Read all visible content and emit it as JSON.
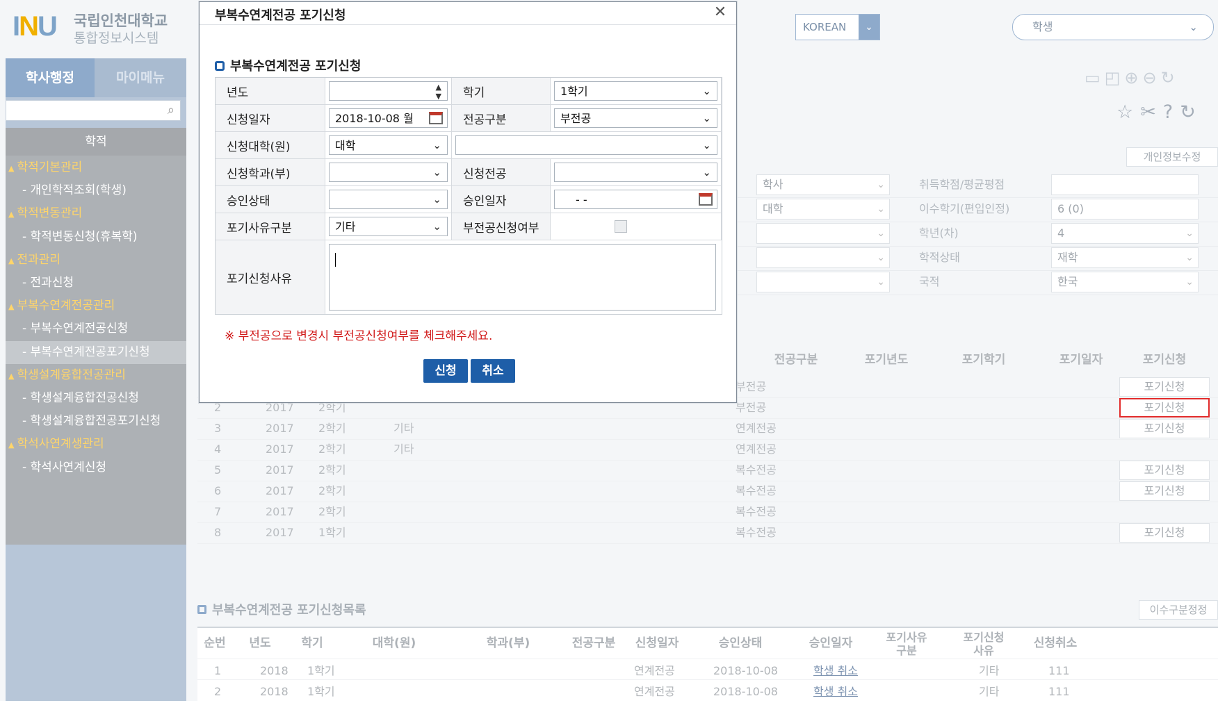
{
  "logo": {
    "mark": "INU",
    "name_line1": "국립인천대학교",
    "name_line2": "통합정보시스템"
  },
  "header": {
    "language": "KOREAN",
    "role": "학생"
  },
  "sidebar": {
    "tab_active": "학사행정",
    "tab_other": "마이메뉴",
    "section": "학적",
    "items": [
      {
        "label": "학적기본관리",
        "type": "cat"
      },
      {
        "label": "- 개인학적조회(학생)",
        "type": "sub"
      },
      {
        "label": "학적변동관리",
        "type": "cat"
      },
      {
        "label": "- 학적변동신청(휴복학)",
        "type": "sub"
      },
      {
        "label": "전과관리",
        "type": "cat"
      },
      {
        "label": "- 전과신청",
        "type": "sub"
      },
      {
        "label": "부복수연계전공관리",
        "type": "cat"
      },
      {
        "label": "- 부복수연계전공신청",
        "type": "sub"
      },
      {
        "label": "- 부복수연계전공포기신청",
        "type": "sub",
        "selected": true
      },
      {
        "label": "학생설계융합전공관리",
        "type": "cat"
      },
      {
        "label": "- 학생설계융합전공신청",
        "type": "sub"
      },
      {
        "label": "- 학생설계융합전공포기신청",
        "type": "sub"
      },
      {
        "label": "학석사연계생관리",
        "type": "cat"
      },
      {
        "label": "- 학석사연계신청",
        "type": "sub"
      }
    ]
  },
  "page": {
    "personal_info_button": "개인정보수정"
  },
  "info_grid": [
    {
      "left": "학사",
      "label": "취득학점/평균평점",
      "value": ""
    },
    {
      "left": "대학",
      "label": "이수학기(편입인정)",
      "value": "6 (0)"
    },
    {
      "left": "",
      "label": "학년(차)",
      "value": "4"
    },
    {
      "left": "",
      "label": "학적상태",
      "value": "재학"
    },
    {
      "left": "",
      "label": "국적",
      "value": "한국"
    }
  ],
  "upper_table": {
    "headers": [
      "전공구분",
      "포기년도",
      "포기학기",
      "포기일자",
      "포기신청"
    ],
    "rows": [
      {
        "no": "",
        "year": "",
        "term": "",
        "reason": "",
        "type": "부전공",
        "btn": "포기신청"
      },
      {
        "no": "2",
        "year": "2017",
        "term": "2학기",
        "reason": "",
        "type": "부전공",
        "btn": "포기신청"
      },
      {
        "no": "3",
        "year": "2017",
        "term": "2학기",
        "reason": "기타",
        "type": "연계전공",
        "btn": "포기신청"
      },
      {
        "no": "4",
        "year": "2017",
        "term": "2학기",
        "reason": "기타",
        "type": "연계전공",
        "btn": ""
      },
      {
        "no": "5",
        "year": "2017",
        "term": "2학기",
        "reason": "",
        "type": "복수전공",
        "btn": "포기신청"
      },
      {
        "no": "6",
        "year": "2017",
        "term": "2학기",
        "reason": "",
        "type": "복수전공",
        "btn": "포기신청"
      },
      {
        "no": "7",
        "year": "2017",
        "term": "2학기",
        "reason": "",
        "type": "복수전공",
        "btn": ""
      },
      {
        "no": "8",
        "year": "2017",
        "term": "1학기",
        "reason": "",
        "type": "복수전공",
        "btn": "포기신청"
      }
    ]
  },
  "lower": {
    "title": "부복수연계전공 포기신청목록",
    "button": "이수구분정정",
    "headers": [
      "순번",
      "년도",
      "학기",
      "대학(원)",
      "학과(부)",
      "전공구분",
      "신청일자",
      "승인상태",
      "승인일자",
      "포기사유\n구분",
      "포기신청\n사유",
      "신청취소"
    ],
    "rows": [
      {
        "no": "1",
        "year": "2018",
        "term": "1학기",
        "type": "연계전공",
        "date": "2018-10-08",
        "status": "학생 취소",
        "reason": "기타",
        "detail": "111"
      },
      {
        "no": "2",
        "year": "2018",
        "term": "1학기",
        "type": "연계전공",
        "date": "2018-10-08",
        "status": "학생 취소",
        "reason": "기타",
        "detail": "111"
      }
    ]
  },
  "modal": {
    "title": "부복수연계전공 포기신청",
    "section": "부복수연계전공 포기신청",
    "labels": {
      "year": "년도",
      "term": "학기",
      "apply_date": "신청일자",
      "major_type": "전공구분",
      "college": "신청대학(원)",
      "dept": "신청학과(부)",
      "major": "신청전공",
      "approval": "승인상태",
      "approval_date": "승인일자",
      "reason_type": "포기사유구분",
      "minor_flag": "부전공신청여부",
      "reason": "포기신청사유"
    },
    "values": {
      "year": "",
      "term": "1학기",
      "apply_date": "2018-10-08 월",
      "major_type": "부전공",
      "college": "대학",
      "college_detail": "",
      "dept": "",
      "major": "",
      "approval": "",
      "approval_date": "- -",
      "reason_type": "기타",
      "reason": ""
    },
    "notice": "※ 부전공으로 변경시 부전공신청여부를 체크해주세요.",
    "apply_button": "신청",
    "cancel_button": "취소"
  }
}
